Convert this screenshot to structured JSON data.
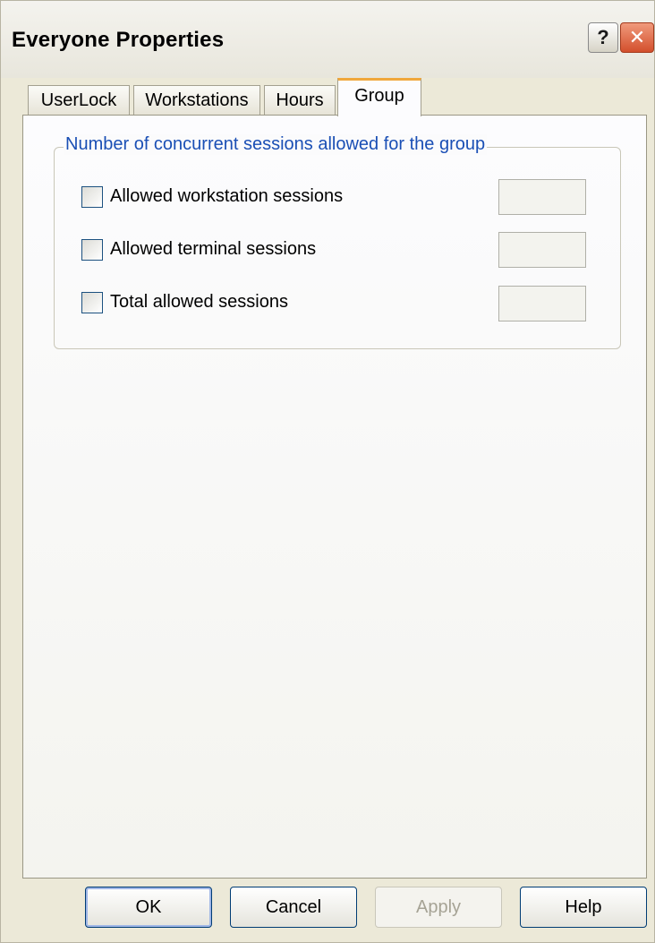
{
  "window": {
    "title": "Everyone Properties",
    "help_glyph": "?",
    "close_glyph": "✕"
  },
  "tabs": [
    {
      "label": "UserLock"
    },
    {
      "label": "Workstations"
    },
    {
      "label": "Hours"
    },
    {
      "label": "Group",
      "active": true
    }
  ],
  "group": {
    "title": "Number of concurrent sessions allowed for the group",
    "rows": [
      {
        "label": "Allowed workstation sessions",
        "checked": false,
        "value": ""
      },
      {
        "label": "Allowed terminal sessions",
        "checked": false,
        "value": ""
      },
      {
        "label": "Total allowed sessions",
        "checked": false,
        "value": ""
      }
    ]
  },
  "buttons": {
    "ok": "OK",
    "cancel": "Cancel",
    "apply": "Apply",
    "help": "Help"
  },
  "colors": {
    "accent_tab": "#f0a73c",
    "group_title": "#1a4fb5",
    "close_button": "#d34f2c"
  }
}
